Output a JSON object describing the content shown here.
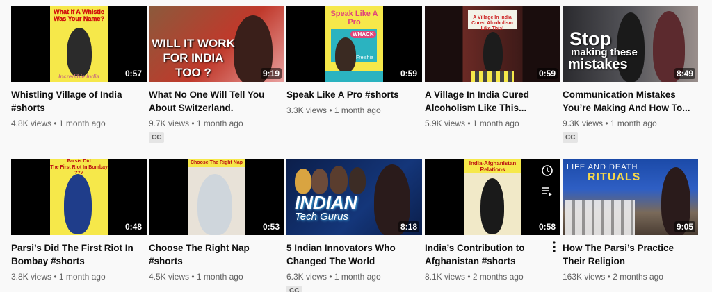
{
  "videos": [
    {
      "title": "Whistling Village of India #shorts",
      "views": "4.8K views",
      "age": "1 month ago",
      "duration": "0:57",
      "poster_top": "What If A Whistle Was Your Name?",
      "poster_bottom": "Incredible India"
    },
    {
      "title": "What No One Will Tell You About Switzerland.",
      "views": "9.7K views",
      "age": "1 month ago",
      "duration": "9:19",
      "cc": "CC",
      "poster_text": "WILL IT WORK FOR INDIA TOO ?"
    },
    {
      "title": "Speak Like A Pro #shorts",
      "views": "3.3K views",
      "age": "1 month ago",
      "duration": "0:59",
      "poster_top": "Speak Like A Pro",
      "poster_badge": "WHACK",
      "poster_brand": "Freishia"
    },
    {
      "title": "A Village In India Cured Alcoholism Like This...",
      "views": "5.9K views",
      "age": "1 month ago",
      "duration": "0:59",
      "poster_top": "A Village In India Cured Alcoholism Like This!"
    },
    {
      "title": "Communication Mistakes You’re Making And How To...",
      "views": "9.3K views",
      "age": "1 month ago",
      "duration": "8:49",
      "cc": "CC",
      "poster_text_1": "Stop",
      "poster_text_2": "making these",
      "poster_text_3": "mistakes"
    },
    {
      "title": "Parsi’s Did The First Riot In Bombay #shorts",
      "views": "3.8K views",
      "age": "1 month ago",
      "duration": "0:48",
      "poster_top_1": "Parsis Did",
      "poster_top_2": "The First Riot In Bombay ???"
    },
    {
      "title": "Choose The Right Nap #shorts",
      "views": "4.5K views",
      "age": "1 month ago",
      "duration": "0:53",
      "poster_top": "Choose The Right Nap"
    },
    {
      "title": "5 Indian Innovators Who Changed The World",
      "views": "6.3K views",
      "age": "1 month ago",
      "duration": "8:18",
      "cc": "CC",
      "poster_text_1": "INDIAN",
      "poster_text_2": "Tech Gurus"
    },
    {
      "title": "India’s Contribution to Afghanistan #shorts",
      "views": "8.1K views",
      "age": "2 months ago",
      "duration": "0:58",
      "poster_top": "India-Afghanistan Relations"
    },
    {
      "title": "How The Parsi’s Practice Their Religion",
      "views": "163K views",
      "age": "2 months ago",
      "duration": "9:05",
      "poster_text_1": "LIFE AND DEATH",
      "poster_text_2": "RITUALS"
    }
  ],
  "separator": "•",
  "icons": {
    "watch_later": "clock-icon",
    "add_queue": "queue-icon",
    "more": "more-vert-icon"
  }
}
